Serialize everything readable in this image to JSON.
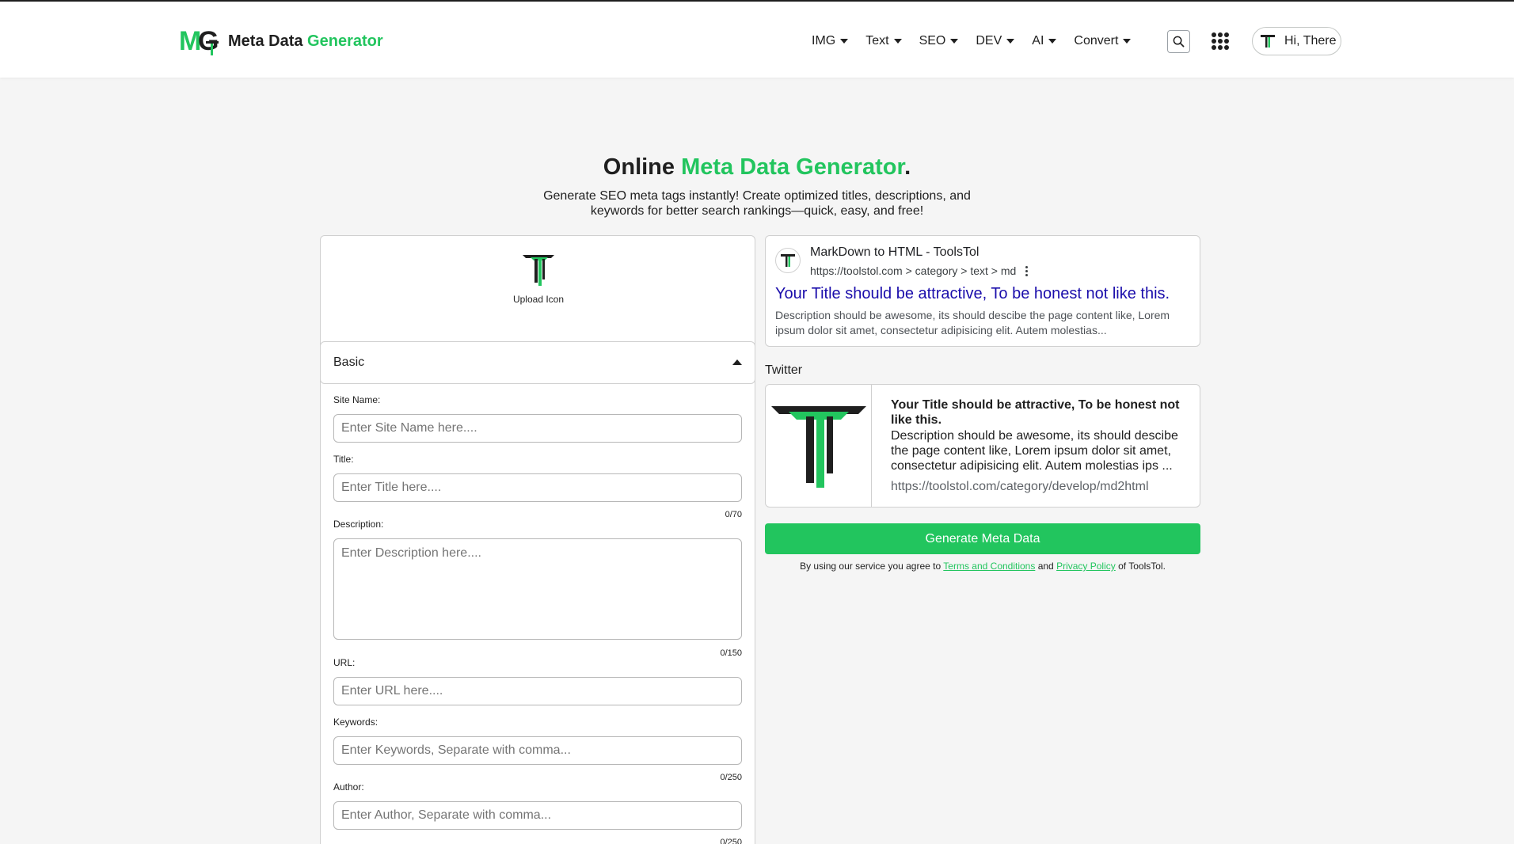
{
  "brand": {
    "logo_letters_left": "M",
    "logo_letters_right": "G",
    "name_prefix": "Meta Data",
    "name_accent": "Generator"
  },
  "nav": {
    "items": [
      "IMG",
      "Text",
      "SEO",
      "DEV",
      "AI",
      "Convert"
    ]
  },
  "user": {
    "greeting": "Hi, There"
  },
  "hero": {
    "title_prefix": "Online",
    "title_accent": "Meta Data Generator",
    "title_suffix": ".",
    "subtitle": "Generate SEO meta tags instantly! Create optimized titles, descriptions, and keywords for better search rankings—quick, easy, and free!"
  },
  "form": {
    "upload_label": "Upload Icon",
    "accordion_label": "Basic",
    "site_name": {
      "label": "Site Name:",
      "placeholder": "Enter Site Name here...."
    },
    "title": {
      "label": "Title:",
      "placeholder": "Enter Title here....",
      "counter": "0/70"
    },
    "description": {
      "label": "Description:",
      "placeholder": "Enter Description here....",
      "counter": "0/150"
    },
    "url": {
      "label": "URL:",
      "placeholder": "Enter URL here...."
    },
    "keywords": {
      "label": "Keywords:",
      "placeholder": "Enter Keywords, Separate with comma...",
      "counter": "0/250"
    },
    "author": {
      "label": "Author:",
      "placeholder": "Enter Author, Separate with comma...",
      "counter": "0/250"
    }
  },
  "google_preview": {
    "site": "MarkDown to HTML - ToolsTol",
    "breadcrumb": "https://toolstol.com > category > text > md",
    "title": "Your Title should be attractive, To be honest not like this.",
    "description": "Description should be awesome, its should descibe the page content like, Lorem ipsum dolor sit amet, consectetur adipisicing elit. Autem molestias..."
  },
  "twitter": {
    "label": "Twitter",
    "title": "Your Title should be attractive, To be honest not like this.",
    "description": "Description should be awesome, its should descibe the page content like, Lorem ipsum dolor sit amet, consectetur adipisicing elit. Autem molestias ips ...",
    "url": "https://toolstol.com/category/develop/md2html"
  },
  "actions": {
    "generate_label": "Generate Meta Data"
  },
  "terms": {
    "prefix": "By using our service you agree to",
    "terms_link": "Terms and Conditions",
    "and": "and",
    "privacy_link": "Privacy Policy",
    "suffix": "of ToolsTol."
  },
  "colors": {
    "accent": "#22c55e",
    "link_blue": "#1a0dab",
    "dark": "#1f1f1f",
    "background": "#f5f5f5"
  }
}
